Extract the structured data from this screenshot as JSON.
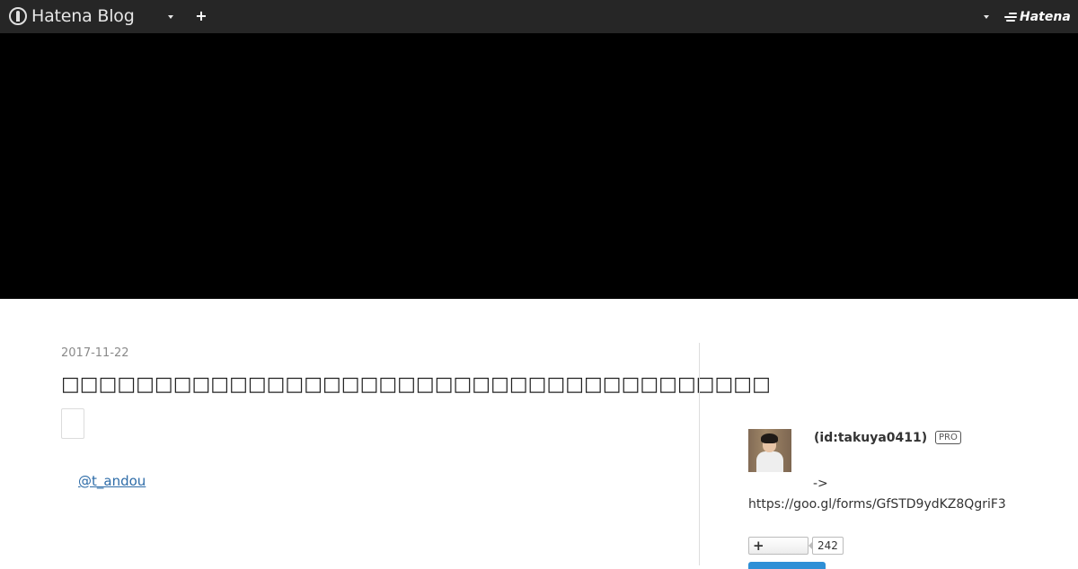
{
  "header": {
    "logo_text": "Hatena Blog",
    "add_label": "+",
    "brand_text": "Hatena"
  },
  "article": {
    "date": "2017-11-22",
    "title": "□□□□□□□□□□□□□□□□□□□□□□□□□□□□□□□□□□□□□□",
    "author_link": "@t_andou"
  },
  "sidebar": {
    "profile_id": "(id:takuya0411)",
    "pro_badge": "PRO",
    "arrow_text": "->",
    "form_url": "https://goo.gl/forms/GfSTD9ydKZ8QgriF3",
    "follow_icon": "+",
    "follow_count": "242"
  }
}
